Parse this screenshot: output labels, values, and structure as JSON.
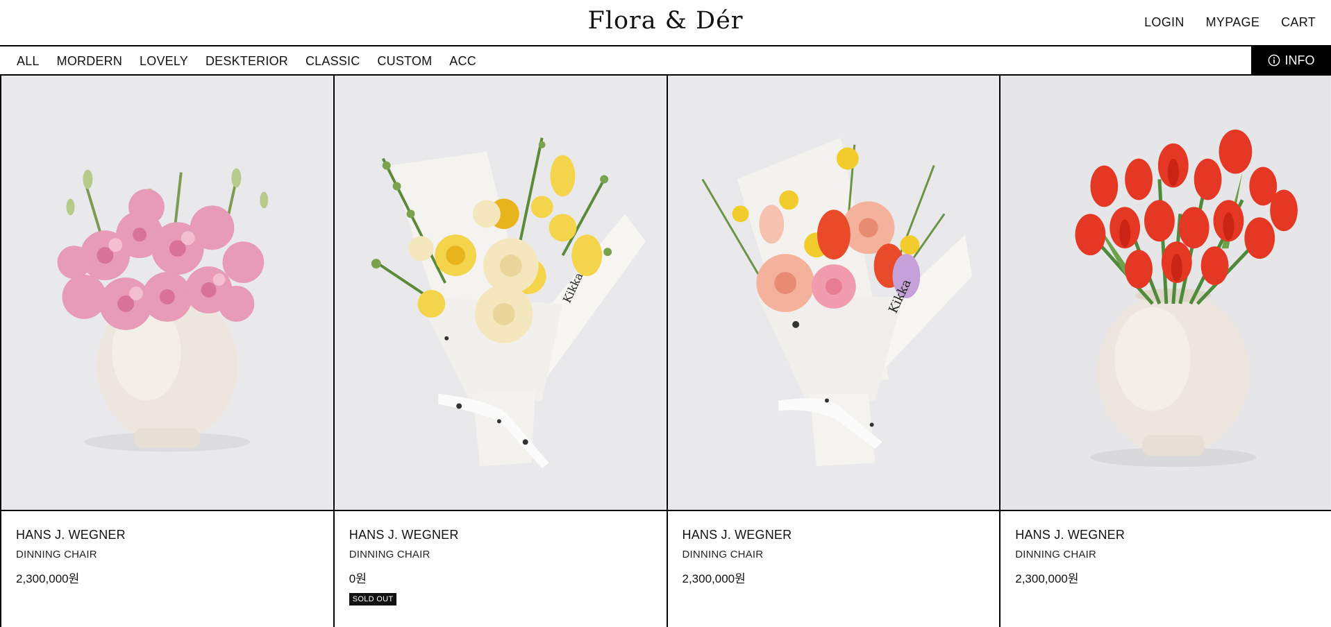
{
  "site": {
    "logo": "Flora & Dér"
  },
  "top_nav": [
    {
      "label": "LOGIN"
    },
    {
      "label": "MYPAGE"
    },
    {
      "label": "CART"
    }
  ],
  "categories": [
    {
      "label": "ALL"
    },
    {
      "label": "MORDERN"
    },
    {
      "label": "LOVELY"
    },
    {
      "label": "DESKTERIOR"
    },
    {
      "label": "CLASSIC"
    },
    {
      "label": "CUSTOM"
    },
    {
      "label": "ACC"
    }
  ],
  "info_button": {
    "label": "INFO",
    "icon": "info-icon"
  },
  "products": [
    {
      "brand": "HANS J. WEGNER",
      "name": "DINNING CHAIR",
      "price": "2,300,000원",
      "image": "pink lisianthus in cream vase"
    },
    {
      "brand": "HANS J. WEGNER",
      "name": "DINNING CHAIR",
      "price": "0원",
      "badge": "SOLD OUT",
      "image": "yellow rose bouquet"
    },
    {
      "brand": "HANS J. WEGNER",
      "name": "DINNING CHAIR",
      "price": "2,300,000원",
      "image": "peach and orange bouquet"
    },
    {
      "brand": "HANS J. WEGNER",
      "name": "DINNING CHAIR",
      "price": "2,300,000원",
      "image": "red tulips in cream vase"
    }
  ],
  "colors": {
    "photo_bg": "#e8e8ea",
    "vase": "#ece6df",
    "badge_bg": "#111111"
  }
}
